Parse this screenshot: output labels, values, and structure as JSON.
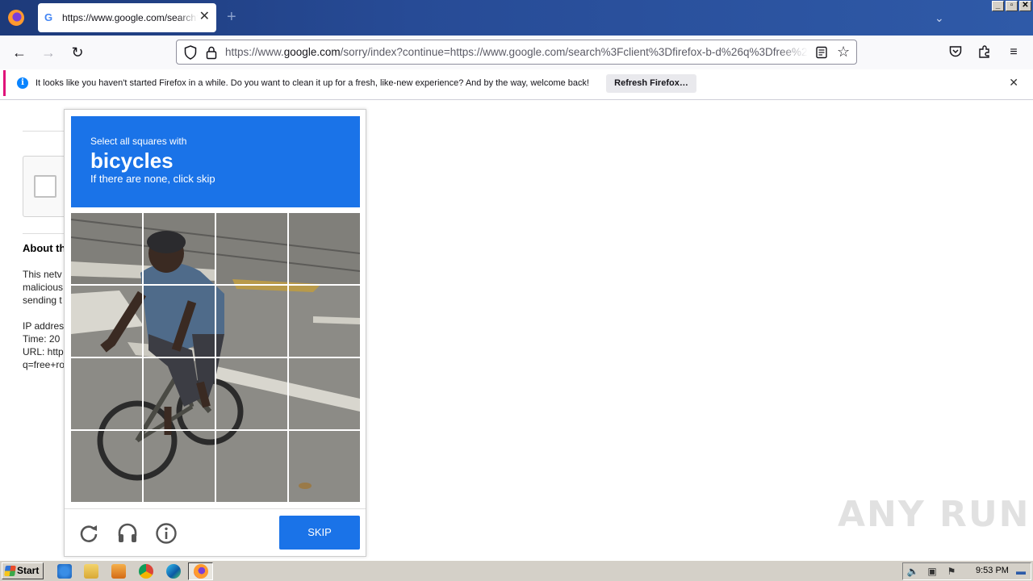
{
  "browser": {
    "tab_title": "https://www.google.com/search?client=firefox",
    "tab_favicon": "G",
    "url_prefix": "https://www.",
    "url_domain": "google.com",
    "url_suffix": "/sorry/index?continue=https://www.google.com/search%3Fclient%3Dfirefox-b-d%26q%3Dfree%2Bro"
  },
  "notification": {
    "message": "It looks like you haven't started Firefox in a while. Do you want to clean it up for a fresh, like-new experience? And by the way, welcome back!",
    "button_label": "Refresh Firefox…"
  },
  "page": {
    "about_heading": "About th",
    "para_lines": [
      "This netv",
      "malicious",
      "sending t"
    ],
    "info_lines": [
      "IP addres",
      "Time: 20",
      "URL: http",
      "q=free+ro"
    ]
  },
  "challenge": {
    "instruction": "Select all squares with",
    "target": "bicycles",
    "hint": "If there are none, click skip",
    "skip_label": "SKIP",
    "grid_size": 4
  },
  "watermark": "ANY RUN",
  "taskbar": {
    "start_label": "Start",
    "clock": "9:53 PM"
  },
  "colors": {
    "challenge_blue": "#1a73e8",
    "notification_accent": "#e0137a",
    "info_blue": "#0a84ff"
  }
}
